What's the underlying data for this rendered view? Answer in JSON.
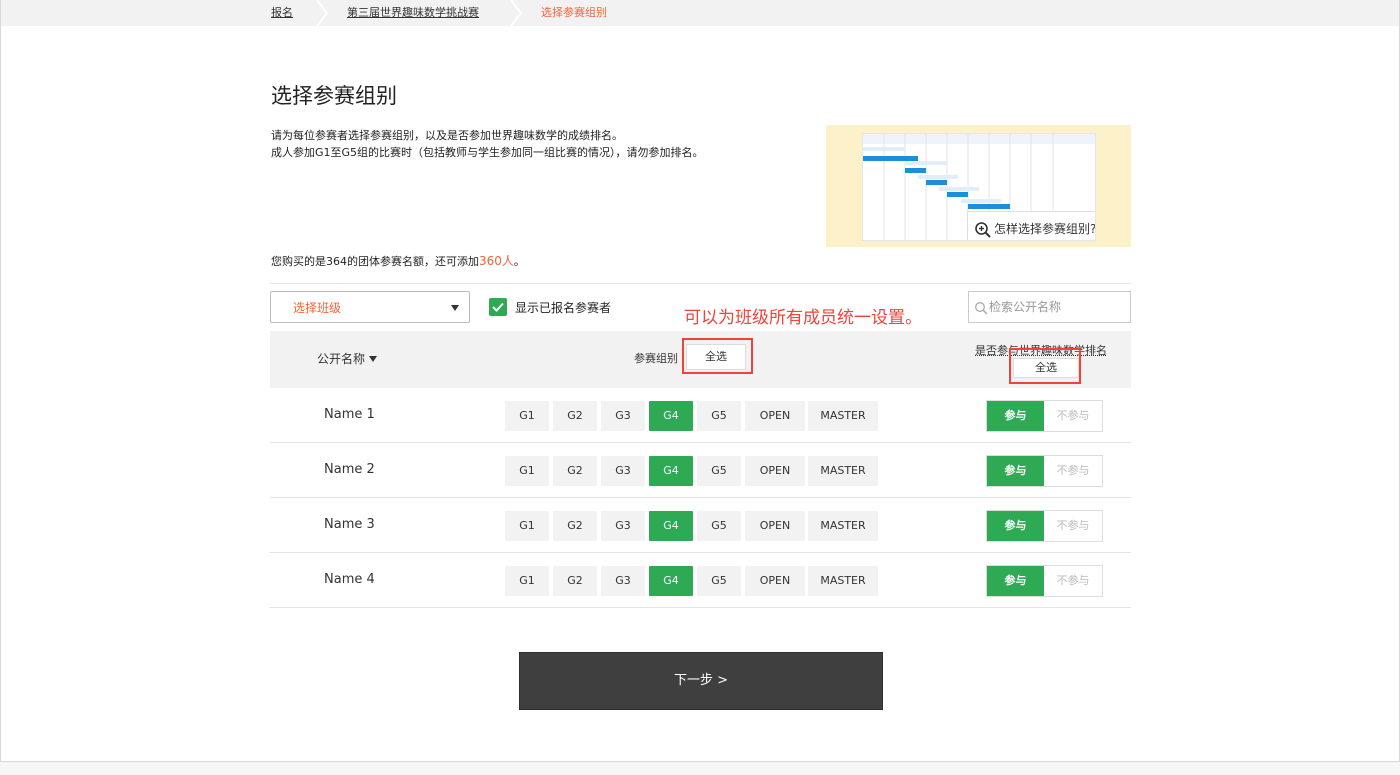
{
  "breadcrumb": {
    "items": [
      {
        "label": "报名"
      },
      {
        "label": "第三届世界趣味数学挑战赛"
      },
      {
        "label": "选择参赛组别"
      }
    ]
  },
  "page": {
    "title": "选择参赛组别",
    "desc_line1": "请为每位参赛者选择参赛组别，以及是否参加世界趣味数学的成绩排名。",
    "desc_line2": "成人参加G1至G5组的比赛时（包括教师与学生参加同一组比赛的情况），请勿参加排名。"
  },
  "guide": {
    "button_label": "怎样选择参赛组别?"
  },
  "quota": {
    "prefix": "您购买的是364的团体参赛名额，还可添加",
    "remaining": "360人",
    "suffix": "。"
  },
  "controls": {
    "class_select": "选择班级",
    "show_registered": "显示已报名参赛者",
    "show_registered_checked": true,
    "search_placeholder": "检索公开名称",
    "annotation": "可以为班级所有成员统一设置。"
  },
  "table": {
    "col_name": "公开名称",
    "col_group": "参赛组别",
    "col_group_selall": "全选",
    "col_rank": "是否参与世界趣味数学排名",
    "col_rank_selall": "全选",
    "groups": [
      "G1",
      "G2",
      "G3",
      "G4",
      "G5",
      "OPEN",
      "MASTER"
    ],
    "participate_yes": "参与",
    "participate_no": "不参与",
    "rows": [
      {
        "name": "Name 1",
        "group": "G4",
        "participate": true
      },
      {
        "name": "Name 2",
        "group": "G4",
        "participate": true
      },
      {
        "name": "Name 3",
        "group": "G4",
        "participate": true
      },
      {
        "name": "Name 4",
        "group": "G4",
        "participate": true
      }
    ]
  },
  "footer": {
    "next_label": "下一步 >"
  },
  "colors": {
    "accent": "#f5623b",
    "green": "#2eaa55",
    "annotation_red": "#f0443a",
    "next_button": "#3f3f3f"
  }
}
